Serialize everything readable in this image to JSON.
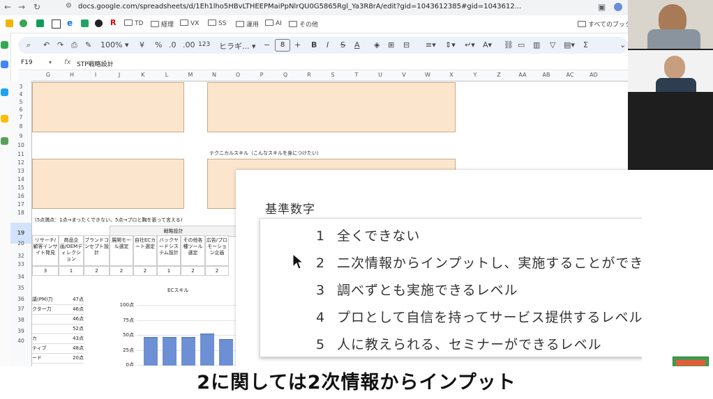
{
  "browser": {
    "url": "docs.google.com/spreadsheets/d/1Eh1lho5HBvLTHEEPMaiPpNlrQU0G5865Rgl_Ya3R8rA/edit?gid=1043612385#gid=1043612...",
    "bookmarks": [
      "TD",
      "経理",
      "VX",
      "SS",
      "運用",
      "AI",
      "その他"
    ],
    "all_bookmarks": "すべてのブックマ"
  },
  "toolbar": {
    "zoom": "100%",
    "currency": "¥",
    "percent": "%",
    "dec_minus": ".0",
    "dec_plus": ".00",
    "number_format": "123",
    "font": "ヒラギ...",
    "font_size": "8"
  },
  "formula_bar": {
    "cell_ref": "F19",
    "content": "STP戦略設計"
  },
  "columns": [
    "G",
    "H",
    "I",
    "J",
    "K",
    "L",
    "M",
    "N",
    "O",
    "P",
    "Q",
    "R",
    "S",
    "T",
    "U",
    "V",
    "W",
    "X",
    "Y",
    "Z",
    "AA",
    "AB",
    "AC",
    "AD"
  ],
  "rows": [
    "3",
    "4",
    "5",
    "6",
    "7",
    "8",
    "9",
    "10",
    "11",
    "12",
    "13",
    "14",
    "15",
    "16",
    "17",
    "18",
    "19",
    "20",
    "32",
    "33",
    "34",
    "35",
    "36",
    "37",
    "38",
    "39",
    "40"
  ],
  "sheet": {
    "tech_skill_label": "テクニカルスキル（こんなスキルを身につけたい）",
    "scale_note": "(5点満点：1点→まったくできない、5点→プロと胸を張って言える)",
    "strategy_header": "戦略設計",
    "skill_headers": [
      "リサーチ/顧客インサイト発見",
      "商品企画/OEMディレクション",
      "ブランドコンセプト設計",
      "展開モール選定",
      "自社ECカート選定",
      "バックヤードシステム設計",
      "その他各種ツール選定",
      "広告/プロモーション企画"
    ],
    "scores": [
      "3",
      "1",
      "2",
      "2",
      "2",
      "1",
      "2",
      "2"
    ],
    "list_rows": [
      {
        "name": "議(PM)力",
        "value": "47点"
      },
      {
        "name": "クター力",
        "value": "46点"
      },
      {
        "name": "",
        "value": "46点"
      },
      {
        "name": "",
        "value": "52点"
      },
      {
        "name": "カ",
        "value": "43点"
      },
      {
        "name": "ティブ",
        "value": "48点"
      },
      {
        "name": "ード",
        "value": "20点"
      }
    ]
  },
  "chart_data": {
    "type": "bar",
    "title": "ECスキル",
    "yticks": [
      "100点",
      "75点",
      "50点",
      "25点",
      "0点"
    ],
    "ylim": [
      0,
      100
    ],
    "values": [
      47,
      46,
      46,
      52,
      43
    ]
  },
  "overlay": {
    "title": "基準数字",
    "levels": [
      {
        "num": "1",
        "text": "全くできない"
      },
      {
        "num": "2",
        "text": "二次情報からインプットし、実施することができる"
      },
      {
        "num": "3",
        "text": "調べずとも実施できるレベル"
      },
      {
        "num": "4",
        "text": "プロとして自信を持ってサービス提供するレベル"
      },
      {
        "num": "5",
        "text": "人に教えられる、セミナーができるレベル"
      }
    ]
  },
  "caption": "2に関しては2次情報からインプット",
  "colors": {
    "peach": "#fce5cd",
    "bar": "#6d8fd3",
    "header_selected": "#d3e3fd"
  }
}
